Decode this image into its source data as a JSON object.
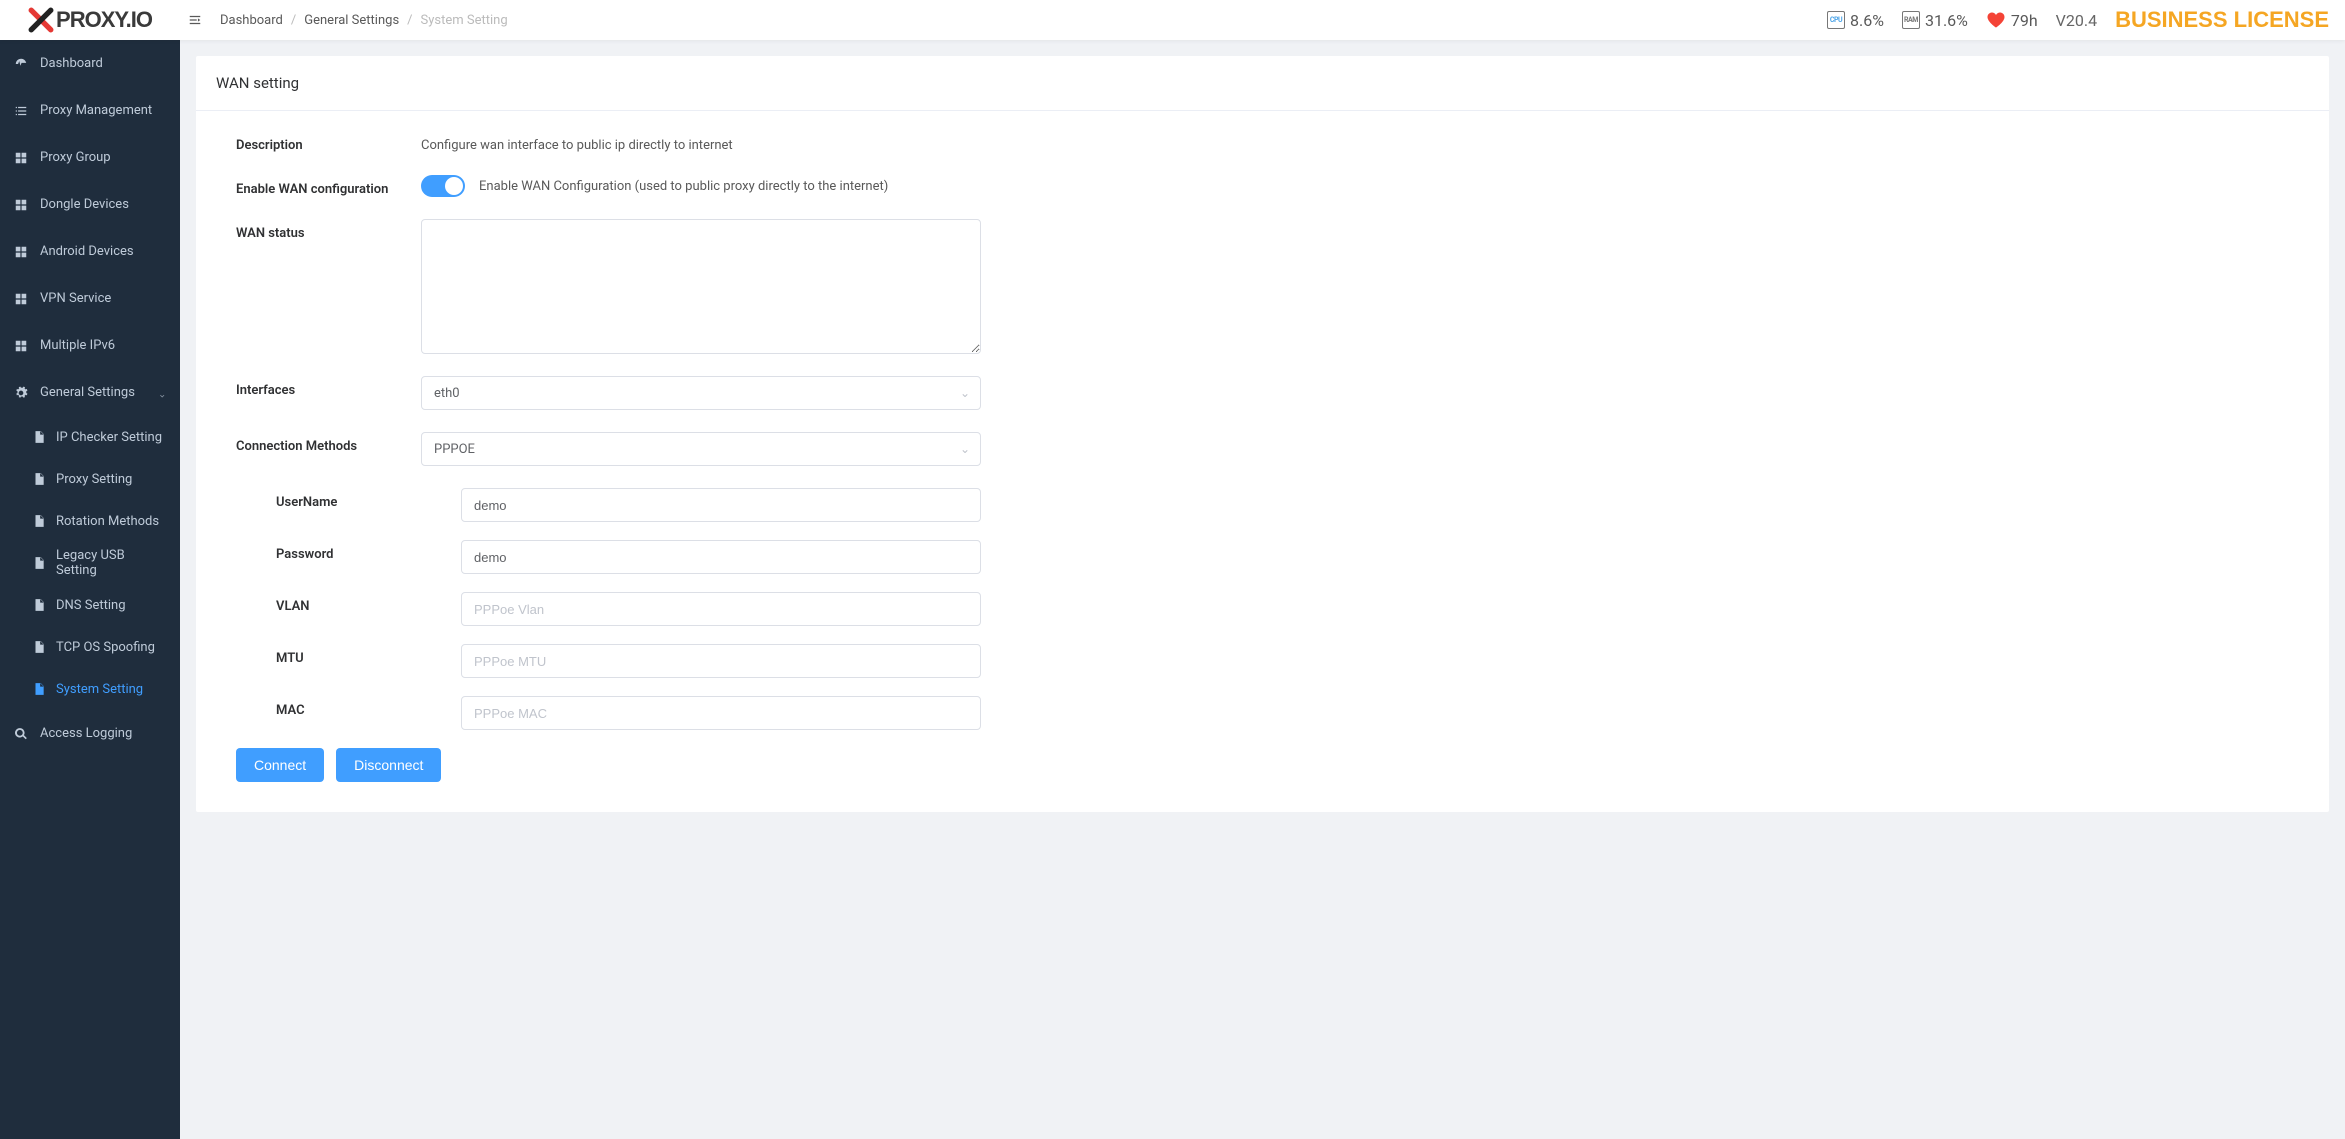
{
  "brand": {
    "name": "PROXY.IO"
  },
  "breadcrumb": {
    "items": [
      "Dashboard",
      "General Settings",
      "System Setting"
    ]
  },
  "header": {
    "cpu": "8.6%",
    "ram": "31.6%",
    "uptime": "79h",
    "version": "V20.4",
    "license": "BUSINESS LICENSE"
  },
  "sidebar": {
    "items": [
      {
        "label": "Dashboard",
        "icon": "dashboard"
      },
      {
        "label": "Proxy Management",
        "icon": "list"
      },
      {
        "label": "Proxy Group",
        "icon": "grid"
      },
      {
        "label": "Dongle Devices",
        "icon": "grid"
      },
      {
        "label": "Android Devices",
        "icon": "grid"
      },
      {
        "label": "VPN Service",
        "icon": "grid"
      },
      {
        "label": "Multiple IPv6",
        "icon": "grid"
      },
      {
        "label": "General Settings",
        "icon": "gear",
        "open": true
      },
      {
        "label": "Access Logging",
        "icon": "search"
      }
    ],
    "subitems": [
      {
        "label": "IP Checker Setting"
      },
      {
        "label": "Proxy Setting"
      },
      {
        "label": "Rotation Methods"
      },
      {
        "label": "Legacy USB Setting"
      },
      {
        "label": "DNS Setting"
      },
      {
        "label": "TCP OS Spoofing"
      },
      {
        "label": "System Setting",
        "active": true
      }
    ]
  },
  "card": {
    "title": "WAN setting",
    "description_label": "Description",
    "description_text": "Configure wan interface to public ip directly to internet",
    "enable_label": "Enable WAN configuration",
    "enable_text": "Enable WAN Configuration (used to public proxy directly to the internet)",
    "enable_value": true,
    "wan_status_label": "WAN status",
    "wan_status_value": "",
    "interfaces_label": "Interfaces",
    "interfaces_value": "eth0",
    "method_label": "Connection Methods",
    "method_value": "PPPOE",
    "fields": {
      "username_label": "UserName",
      "username_value": "demo",
      "password_label": "Password",
      "password_value": "demo",
      "vlan_label": "VLAN",
      "vlan_placeholder": "PPPoe Vlan",
      "mtu_label": "MTU",
      "mtu_placeholder": "PPPoe MTU",
      "mac_label": "MAC",
      "mac_placeholder": "PPPoe MAC"
    },
    "buttons": {
      "connect": "Connect",
      "disconnect": "Disconnect"
    }
  }
}
